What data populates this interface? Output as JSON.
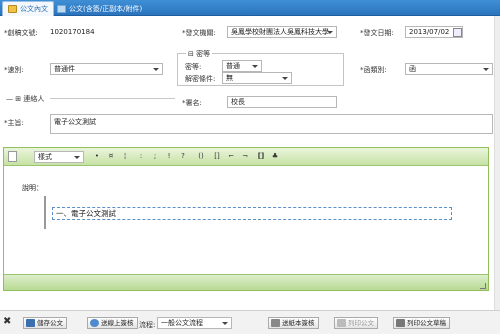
{
  "tabs": [
    {
      "label": "公文內文",
      "active": true
    },
    {
      "label": "公文(含簽/正副本/附件)",
      "active": false
    }
  ],
  "form": {
    "doc_no_label": "*創稿文號:",
    "doc_no_value": "1020170184",
    "issuer_label": "*發文機關:",
    "issuer_value": "吳鳳學校財團法人吳鳳科技大學",
    "date_label": "*發文日期:",
    "date_value": "2013/07/02",
    "type_label": "*速別:",
    "type_value": "普通件",
    "secret_legend": "密等",
    "secret_level_label": "密等:",
    "secret_level_value": "普通",
    "declass_label": "解密條件:",
    "declass_value": "無",
    "category_label": "*函類別:",
    "category_value": "函",
    "contact_legend": "連絡人",
    "signer_label": "*署名:",
    "signer_value": "校長",
    "subject_label": "*主旨:",
    "subject_value": "電子公文測試"
  },
  "editor": {
    "style_select": "樣式",
    "buttons": [
      "•",
      "¤",
      "¦",
      "!",
      "?",
      "()",
      "[]",
      "⌐",
      "⌐",
      "[]"
    ],
    "heading": "說明：",
    "item": "一、電子公文測試"
  },
  "footer": {
    "save_label": "儲存公文",
    "submit_label": "送線上簽核",
    "flow_label": "流程:",
    "flow_value": "一般公文流程",
    "paper_label": "送紙本簽核",
    "print_label": "列印公文",
    "print_draft_label": "列印公文草稿"
  }
}
